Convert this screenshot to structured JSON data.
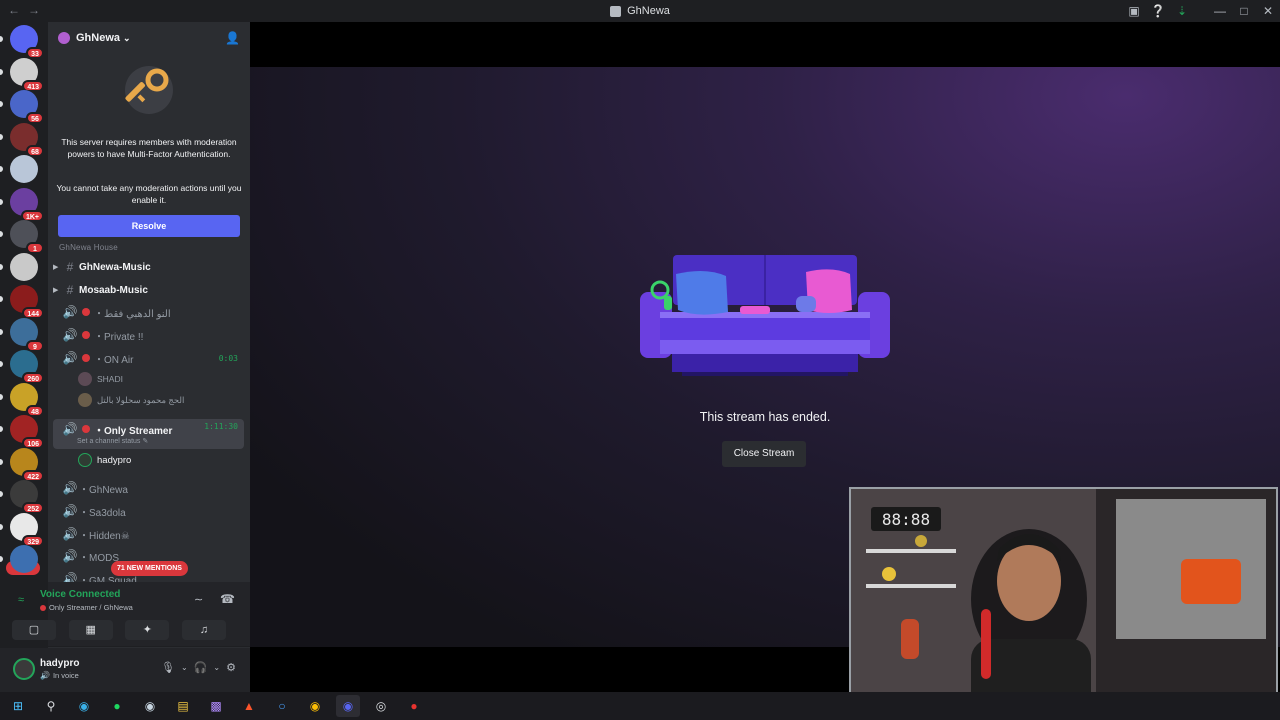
{
  "window": {
    "title": "GhNewa"
  },
  "server": {
    "name": "GhNewa"
  },
  "guilds": [
    {
      "badge": "33",
      "color": "#5865f2"
    },
    {
      "badge": "413",
      "color": "#cfcfcf"
    },
    {
      "badge": "56",
      "color": "#4a66c9"
    },
    {
      "badge": "68",
      "color": "#7a2d2d"
    },
    {
      "badge": "",
      "color": "#b9c6d8"
    },
    {
      "badge": "1K+",
      "color": "#6b3fa0"
    },
    {
      "badge": "1",
      "color": "#4e5058"
    },
    {
      "badge": "",
      "color": "#c9c9c9"
    },
    {
      "badge": "144",
      "color": "#8b1c1c"
    },
    {
      "badge": "9",
      "color": "#3d6e9a"
    },
    {
      "badge": "260",
      "color": "#2b6d8f"
    },
    {
      "badge": "48",
      "color": "#c9a227"
    },
    {
      "badge": "106",
      "color": "#a12323"
    },
    {
      "badge": "422",
      "color": "#b8861c"
    },
    {
      "badge": "252",
      "color": "#3b3b3b"
    },
    {
      "badge": "329",
      "color": "#e8e8e8"
    },
    {
      "badge": "",
      "color": "#3d6fb0"
    }
  ],
  "guild_new_badge": "NEW",
  "mfa": {
    "text1": "This server requires members with moderation powers to have Multi-Factor Authentication.",
    "text2": "You cannot take any moderation actions until you enable it.",
    "resolve": "Resolve"
  },
  "category": "GhNewa House",
  "channels": {
    "music1": "GhNewa-Music",
    "music2": "Mosaab-Music",
    "voice_arabic1": "・النو الدهبي فقط",
    "private": "・Private !!",
    "on_air": "・ON Air",
    "on_air_timer": "0:03",
    "only_streamer": "・Only Streamer",
    "only_streamer_timer": "1:11:30",
    "channel_status": "Set a channel status",
    "ghnewa": "・GhNewa",
    "sa3dola": "・Sa3dola",
    "hidden": "・Hidden☠",
    "mods": "・MODS",
    "gm_squad": "・GM Squad"
  },
  "members": {
    "shadi": "SHADI",
    "arabic_member": "الحج محمود سحلولا بالتل",
    "hadypro": "hadypro"
  },
  "mentions_pill": "71 NEW MENTIONS",
  "voice": {
    "status": "Voice Connected",
    "channel": "Only Streamer / GhNewa"
  },
  "user": {
    "name": "hadypro",
    "status": "In voice"
  },
  "stream": {
    "ended_text": "This stream has ended.",
    "close_button": "Close Stream"
  },
  "colors": {
    "accent": "#5865f2",
    "online": "#23a55a",
    "danger": "#da373c"
  }
}
